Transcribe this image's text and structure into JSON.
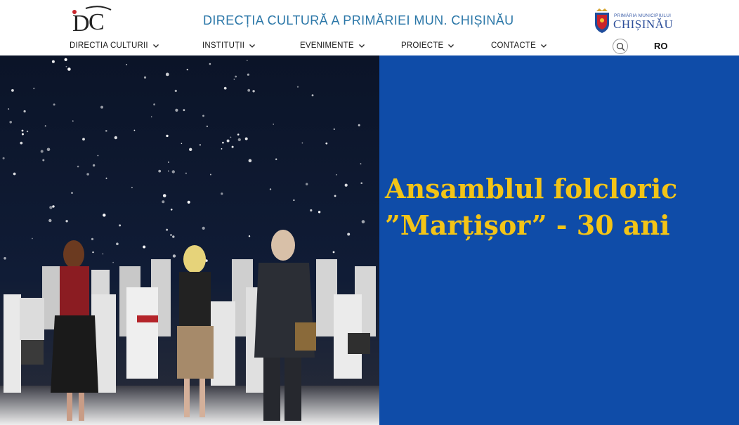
{
  "header": {
    "logo_text": "DC",
    "title": "DIRECȚIA CULTURĂ A PRIMĂRIEI MUN. CHIȘINĂU",
    "city_logo": {
      "small": "PRIMĂRIA MUNICIPIULUI",
      "big": "CHIȘINĂU"
    }
  },
  "nav": {
    "items": [
      {
        "label": "DIRECTIA CULTURII"
      },
      {
        "label": "INSTITUȚII"
      },
      {
        "label": "EVENIMENTE"
      },
      {
        "label": "PROIECTE"
      },
      {
        "label": "CONTACTE"
      }
    ],
    "search_icon": "search-icon",
    "language": "RO"
  },
  "hero": {
    "title_line1": "Ansamblul folcloric",
    "title_line2": "”Marțișor” - 30 ani",
    "panel_color": "#0f4ca8",
    "title_color": "#f3c417"
  }
}
